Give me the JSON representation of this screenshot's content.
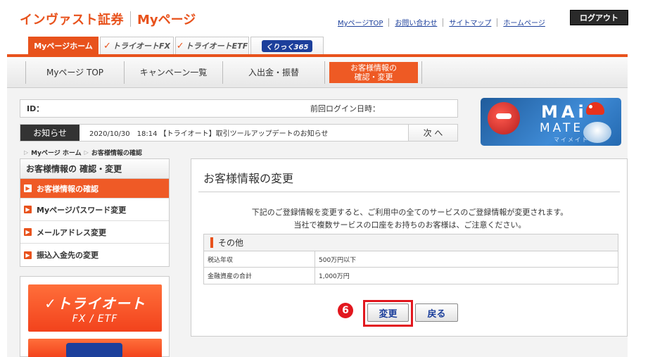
{
  "header": {
    "brand": "インヴァスト証券",
    "mypage": "Myページ",
    "links": [
      "MyページTOP",
      "お問い合わせ",
      "サイトマップ",
      "ホームページ"
    ],
    "logout": "ログアウト"
  },
  "service_tabs": [
    {
      "label": "Myページホーム"
    },
    {
      "label": "トライオートFX"
    },
    {
      "label": "トライオートETF"
    },
    {
      "label": "くりっく365"
    }
  ],
  "main_nav": {
    "items": [
      "Myページ TOP",
      "キャンペーン一覧",
      "入出金・振替"
    ],
    "active_line1": "お客様情報の",
    "active_line2": "確認・変更"
  },
  "id_bar": {
    "id_label": "ID：",
    "last_login_label": "前回ログイン日時："
  },
  "news": {
    "label": "お知らせ",
    "text": "2020/10/30　18:14 【トライオート】取引ツールアップデートのお知らせ",
    "next": "次 へ"
  },
  "maimate": {
    "mai": "MAi",
    "mate": "MATE",
    "kana": "マイメイト"
  },
  "breadcrumb": [
    "Myページ ホーム",
    "お客様情報の確認"
  ],
  "sidebar": {
    "heading": "お客様情報の 確認・変更",
    "items": [
      {
        "label": "お客様情報の確認",
        "active": true
      },
      {
        "label": "Myページパスワード変更",
        "active": false
      },
      {
        "label": "メールアドレス変更",
        "active": false
      },
      {
        "label": "振込入金先の変更",
        "active": false
      }
    ],
    "fx_banner_line1": "トライオート",
    "fx_banner_line2": "FX / ETF"
  },
  "main": {
    "title": "お客様情報の変更",
    "message_line1": "下記のご登録情報を変更すると、ご利用中の全てのサービスのご登録情報が変更されます。",
    "message_line2": "当社で複数サービスの口座をお持ちのお客様は、ご注意ください。",
    "table_heading": "その他",
    "rows": [
      {
        "key": "税込年収",
        "value": "500万円以下"
      },
      {
        "key": "金融資産の合計",
        "value": "1,000万円"
      }
    ],
    "step_number": "6",
    "change_button": "変更",
    "back_button": "戻る"
  },
  "colors": {
    "accent": "#e8521c",
    "highlight": "#e2171e",
    "link": "#1c3f9b"
  }
}
